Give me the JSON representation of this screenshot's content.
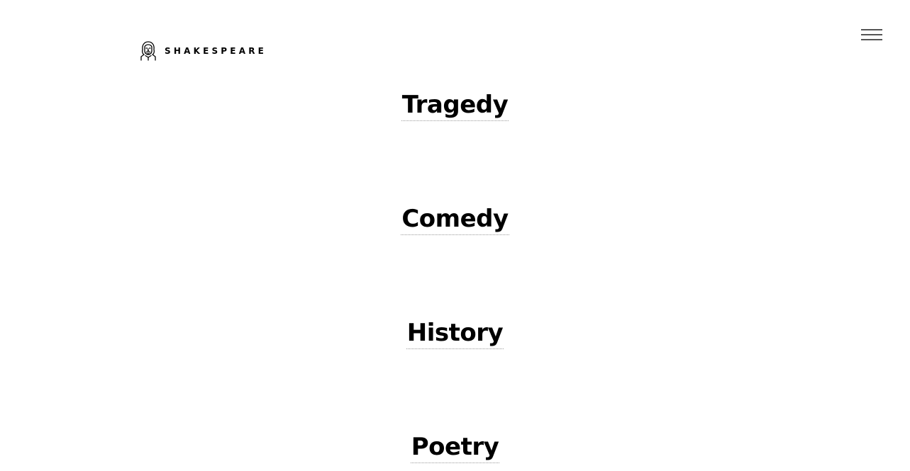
{
  "header": {
    "logo_icon": "shakespeare-portrait-icon",
    "logo_text": "SHAKESPEARE",
    "menu_icon": "hamburger-menu-icon"
  },
  "genres": [
    {
      "label": "Tragedy"
    },
    {
      "label": "Comedy"
    },
    {
      "label": "History"
    },
    {
      "label": "Poetry"
    }
  ],
  "colors": {
    "background": "#ffffff",
    "text": "#000000",
    "menu_bars": "#555555",
    "link_underline": "#999999"
  }
}
